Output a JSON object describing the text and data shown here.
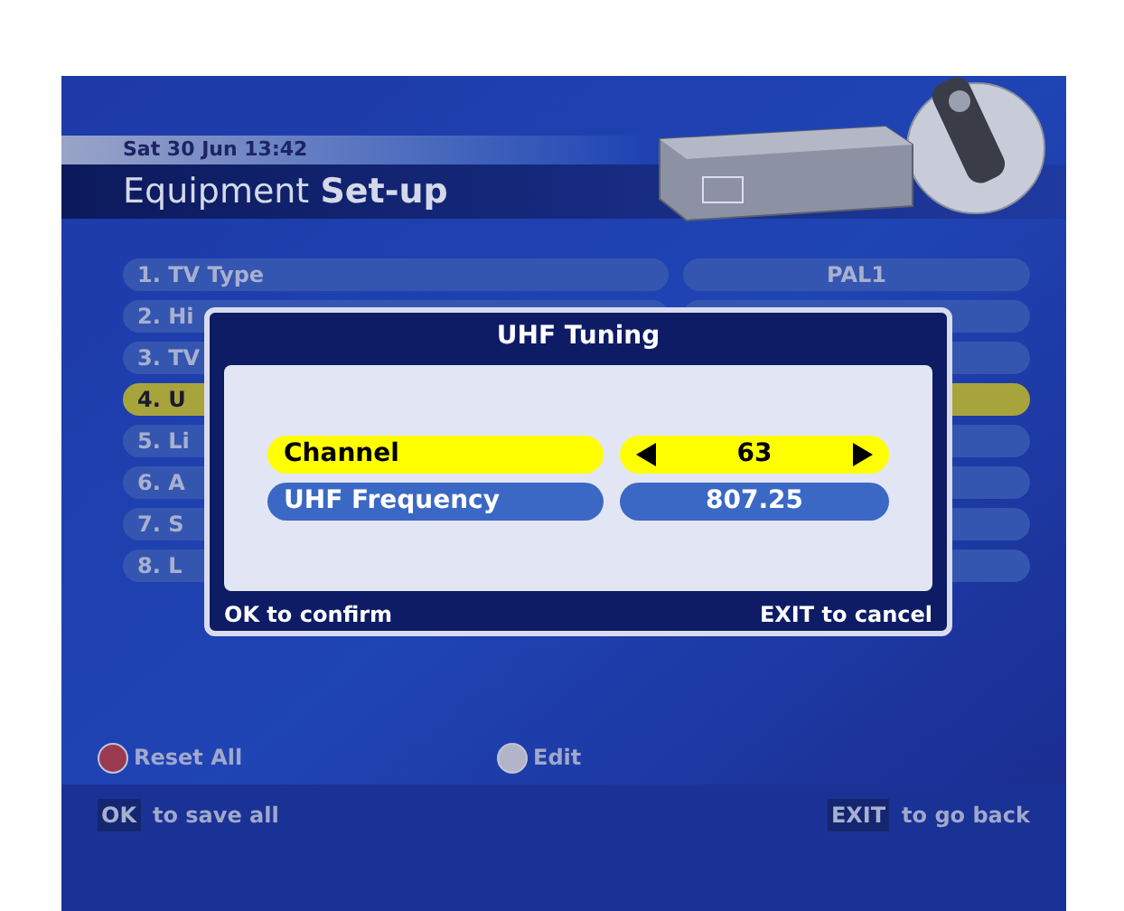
{
  "screen": {
    "datetime": "Sat 30 Jun 13:42",
    "title": "Equipment **Set-up**"
  },
  "menu": [
    {
      "label": "1. TV Type",
      "value": "PAL1",
      "selected": false
    },
    {
      "label": "2. Hi",
      "selected": false
    },
    {
      "label": "3. TV",
      "selected": false
    },
    {
      "label": "4. U",
      "selected": true
    },
    {
      "label": "5. Li",
      "selected": false
    },
    {
      "label": "6. A",
      "selected": false
    },
    {
      "label": "7. S",
      "selected": false
    },
    {
      "label": "8. L",
      "selected": false
    }
  ],
  "dialog": {
    "title": "UHF Tuning",
    "fields": [
      {
        "label": "Channel",
        "value": "63",
        "selected": true,
        "kind": "spinner"
      },
      {
        "label": "UHF Frequency",
        "value": "807.25",
        "selected": false,
        "kind": "readout"
      }
    ],
    "confirm_hint": "OK to confirm",
    "cancel_hint": "EXIT to cancel"
  },
  "color_keys": [
    {
      "label": "Reset All",
      "color": "#9a3a50"
    },
    {
      "label": "Edit",
      "color": "#b4b4c8"
    }
  ],
  "footer": {
    "left": {
      "key": "OK",
      "text": "to save all"
    },
    "right": {
      "key": "EXIT",
      "text": "to go back"
    }
  }
}
